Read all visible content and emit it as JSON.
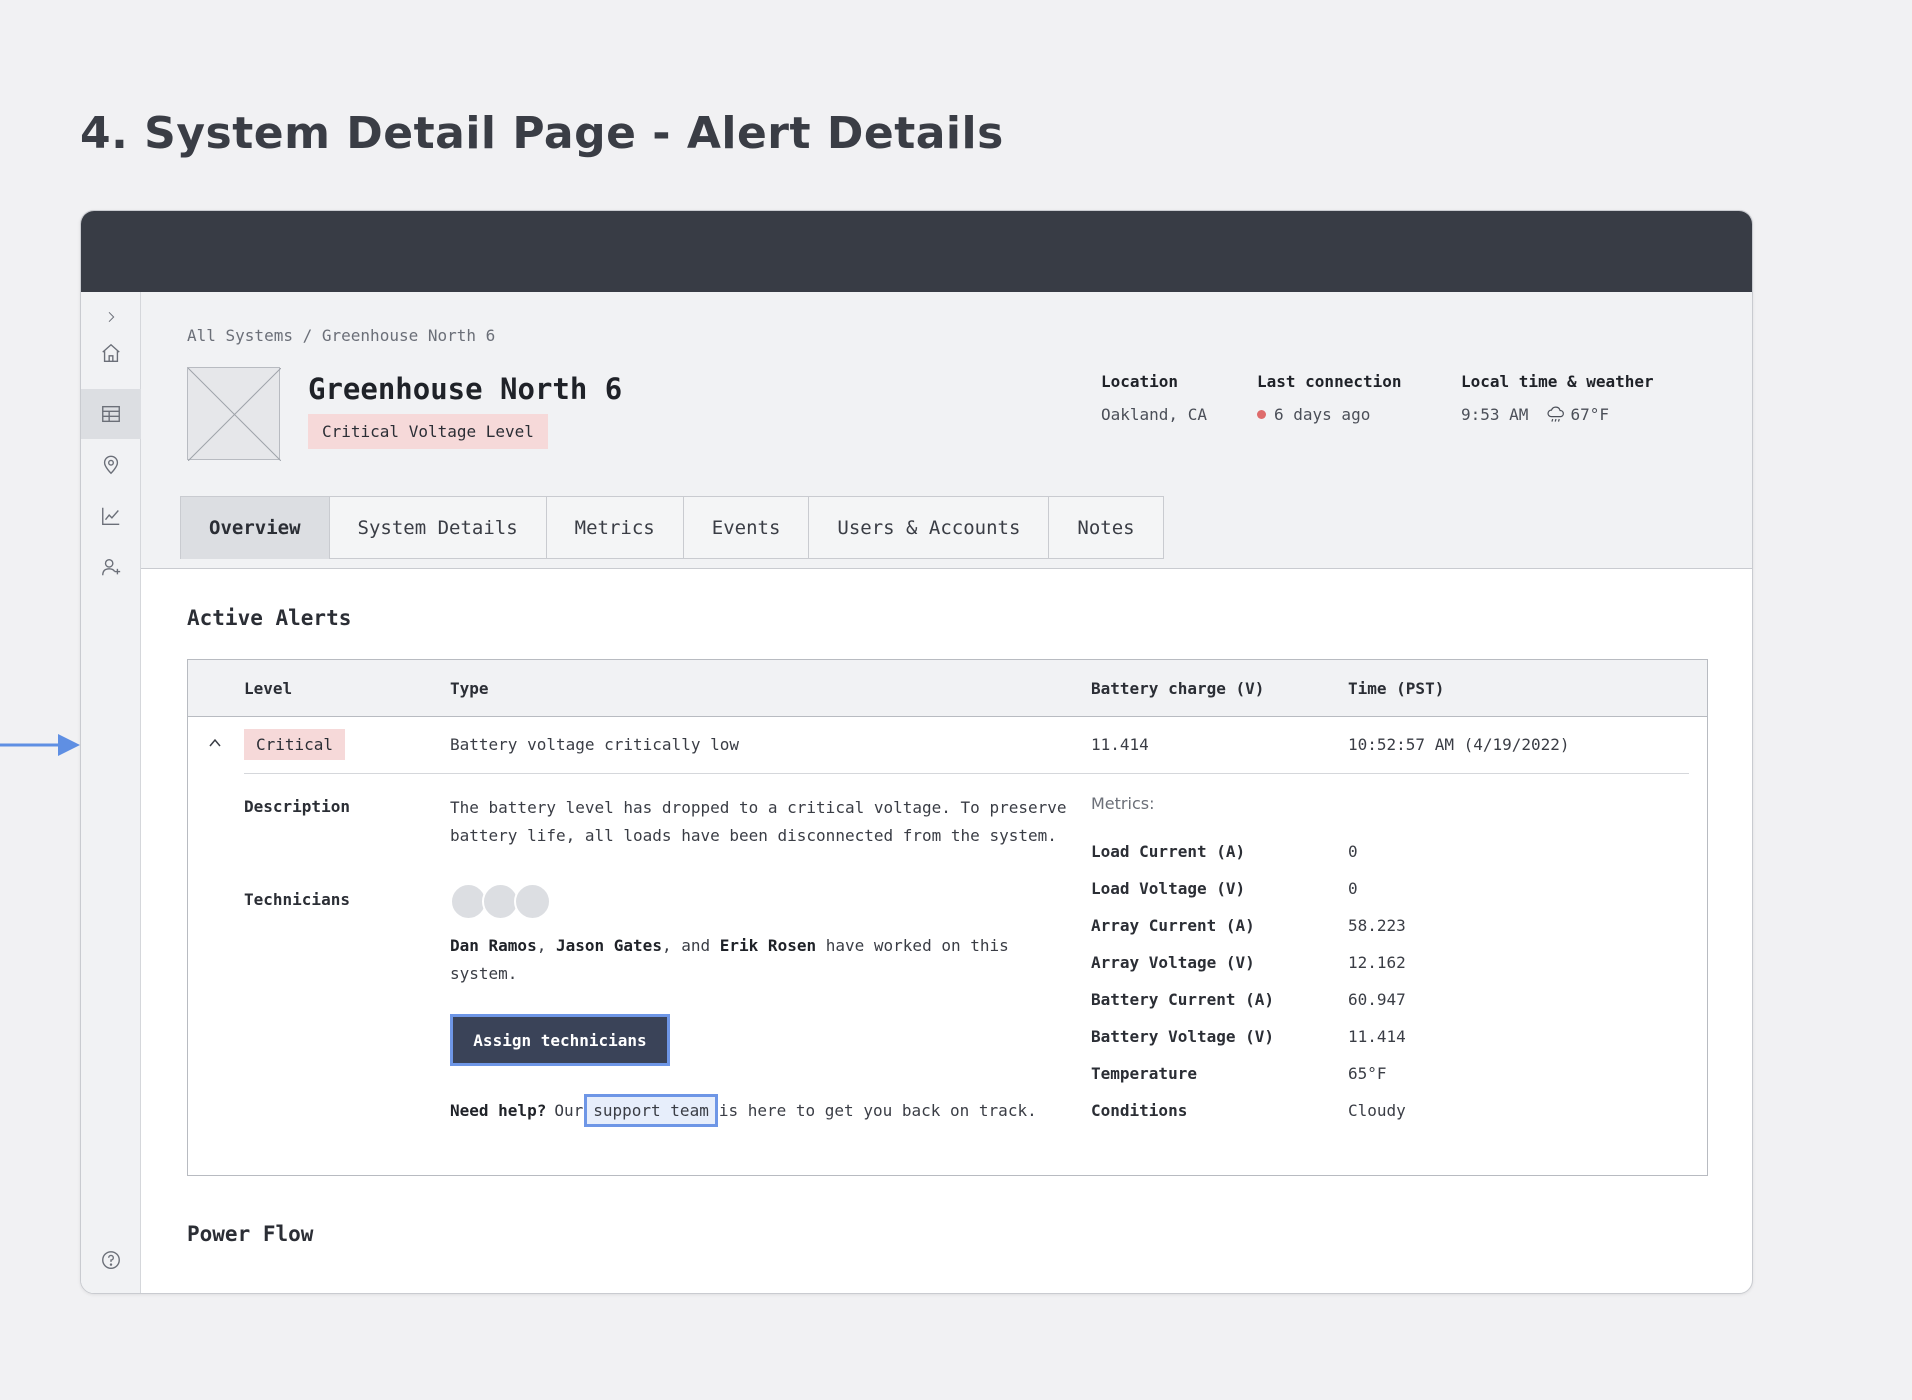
{
  "page": {
    "title": "4. System Detail Page - Alert Details"
  },
  "colors": {
    "topbar": "#383c45",
    "critical_badge_bg": "#f6d9d9",
    "status_dot": "#de6b6b",
    "focus_ring": "#6e96e6",
    "primary_button": "#3a4358"
  },
  "sidebar": {
    "icons": [
      "chevron-right-icon",
      "home-icon",
      "table-icon",
      "location-pin-icon",
      "chart-line-icon",
      "add-user-icon",
      "help-icon"
    ],
    "active": "table-icon"
  },
  "breadcrumb": {
    "root": "All Systems",
    "separator": "/",
    "current": "Greenhouse North 6"
  },
  "system": {
    "name": "Greenhouse North 6",
    "status_badge": "Critical Voltage Level",
    "location_label": "Location",
    "location_value": "Oakland, CA",
    "last_connection_label": "Last connection",
    "last_connection_value": "6 days ago",
    "local_time_label": "Local time & weather",
    "local_time_value": "9:53 AM",
    "weather_value": "67°F",
    "weather_icon": "rain-cloud-icon"
  },
  "tabs": [
    {
      "label": "Overview",
      "active": true
    },
    {
      "label": "System Details",
      "active": false
    },
    {
      "label": "Metrics",
      "active": false
    },
    {
      "label": "Events",
      "active": false
    },
    {
      "label": "Users & Accounts",
      "active": false
    },
    {
      "label": "Notes",
      "active": false
    }
  ],
  "active_alerts": {
    "title": "Active Alerts",
    "columns": [
      "Level",
      "Type",
      "Battery charge (V)",
      "Time (PST)"
    ],
    "alert": {
      "level": "Critical",
      "type": "Battery voltage critically low",
      "battery_charge": "11.414",
      "time": "10:52:57 AM (4/19/2022)",
      "description_label": "Description",
      "description": "The battery level has dropped to a critical voltage. To preserve battery life, all loads have been disconnected from the system.",
      "technicians_label": "Technicians",
      "tech_1": "Dan Ramos",
      "tech_sep_1": ",",
      "tech_2": "Jason Gates",
      "tech_sep_2": ", and",
      "tech_3": "Erik Rosen",
      "tech_suffix": "have worked on this system.",
      "assign_button": "Assign technicians",
      "help_bold": "Need help?",
      "help_pre": "Our",
      "help_link": "support team",
      "help_post": "is here to get you back on track.",
      "metrics_title": "Metrics:",
      "metrics": [
        {
          "name": "Load Current (A)",
          "value": "0"
        },
        {
          "name": "Load Voltage (V)",
          "value": "0"
        },
        {
          "name": "Array Current (A)",
          "value": "58.223"
        },
        {
          "name": "Array Voltage (V)",
          "value": "12.162"
        },
        {
          "name": "Battery Current (A)",
          "value": "60.947"
        },
        {
          "name": "Battery Voltage (V)",
          "value": "11.414"
        },
        {
          "name": "Temperature",
          "value": "65°F"
        },
        {
          "name": "Conditions",
          "value": "Cloudy"
        }
      ]
    }
  },
  "power_flow": {
    "title": "Power Flow"
  }
}
